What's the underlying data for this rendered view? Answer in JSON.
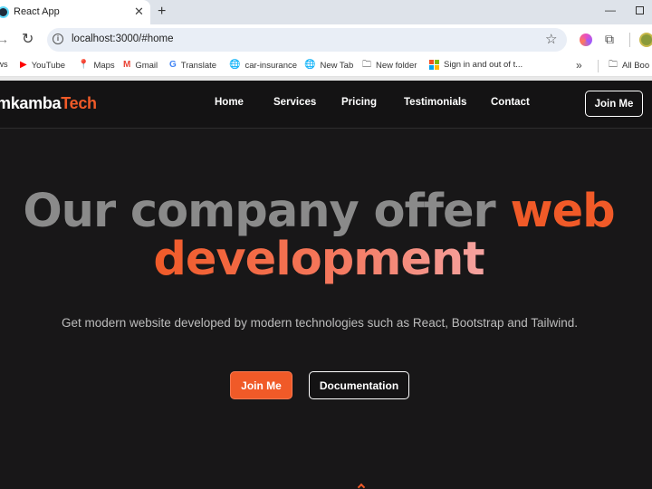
{
  "browser": {
    "tab_title": "React App",
    "url": "localhost:3000/#home",
    "bookmarks": [
      "ws",
      "YouTube",
      "Maps",
      "Gmail",
      "Translate",
      "car-insurance",
      "New Tab",
      "New folder",
      "Sign in and out of t...",
      "All Boo"
    ]
  },
  "site": {
    "brand_prefix": "mkamba",
    "brand_suffix": "Tech",
    "nav": [
      "Home",
      "Services",
      "Pricing",
      "Testimonials",
      "Contact"
    ],
    "join_label": "Join Me"
  },
  "hero": {
    "line1": "Our company offer ",
    "accent": "web",
    "line2": "development",
    "subtitle": "Get modern website developed by modern technologies such as React, Bootstrap and Tailwind.",
    "primary_button": "Join Me",
    "secondary_button": "Documentation"
  },
  "colors": {
    "accent": "#f05a28",
    "background": "#181718",
    "muted_heading": "#8a8a8a"
  }
}
